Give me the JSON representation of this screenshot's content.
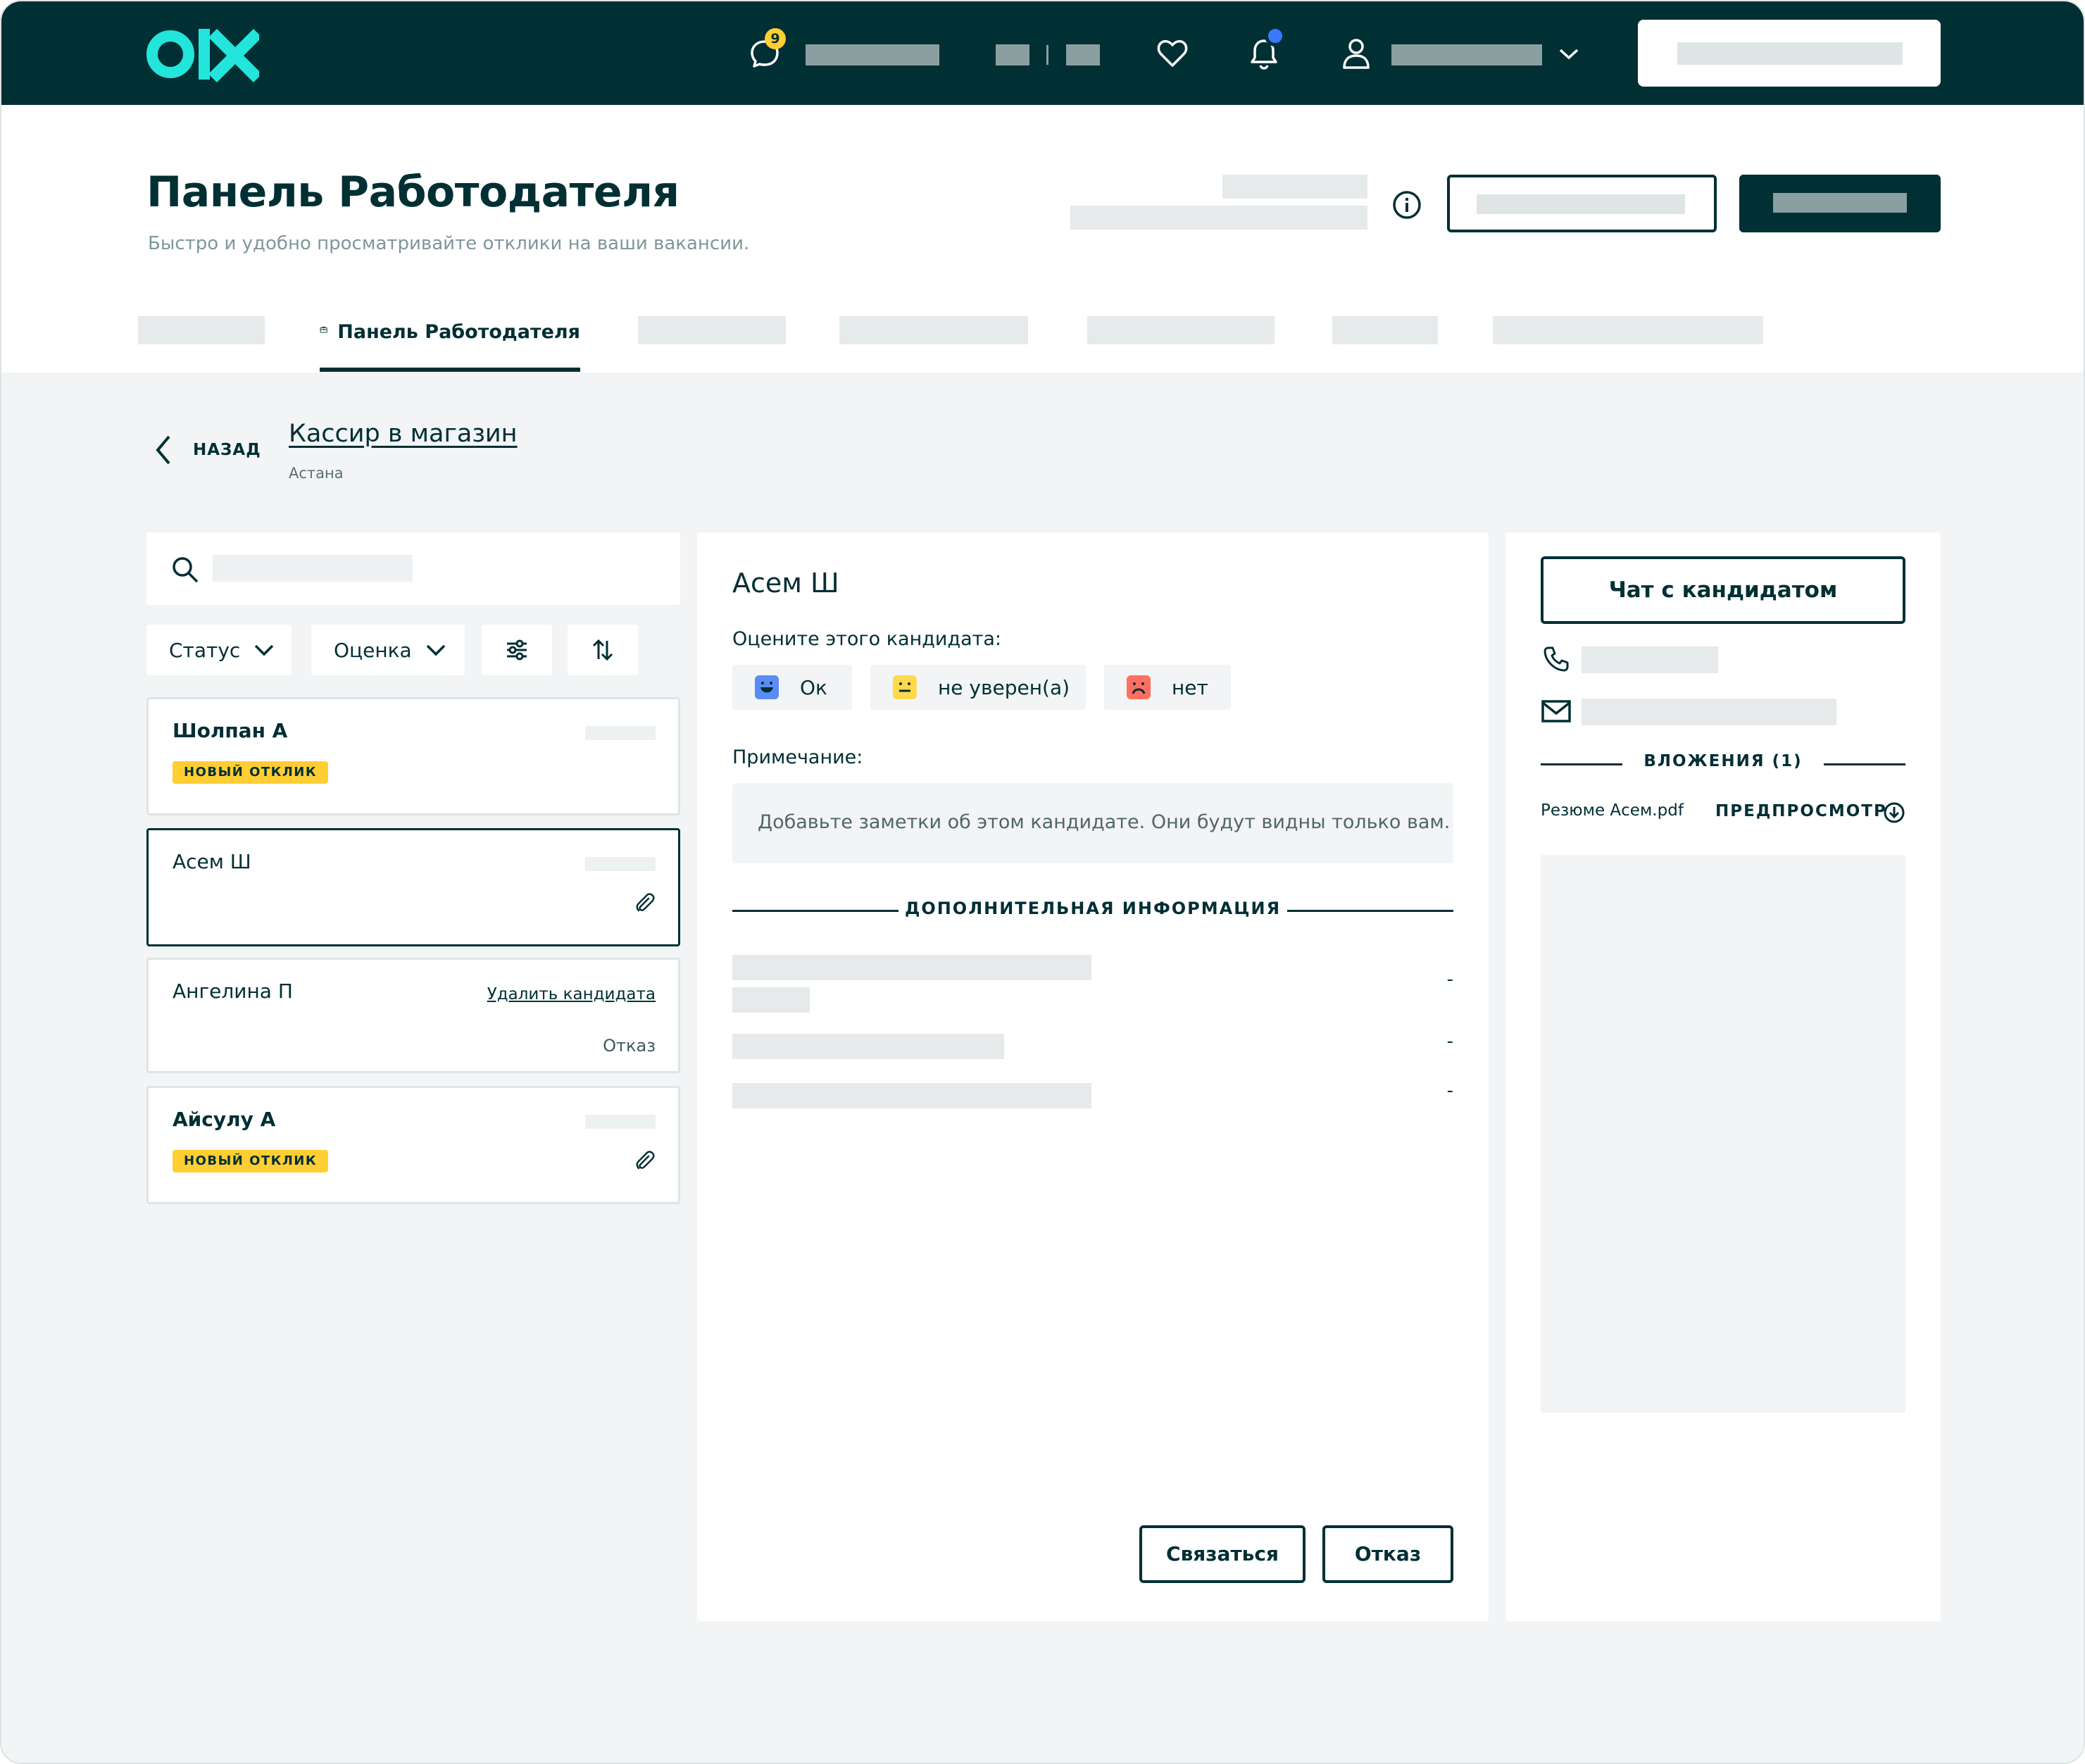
{
  "colors": {
    "header_bg": "#002f34",
    "accent_teal": "#23e5db",
    "badge_yellow": "#ffce32",
    "notification_blue": "#3a77ff",
    "rating_ok": "#5a8cf5",
    "rating_unsure": "#ffd84d",
    "rating_no": "#ff6f61"
  },
  "header": {
    "logo": "olx-logo",
    "chat_badge_count": "9"
  },
  "page": {
    "title": "Панель Работодателя",
    "subtitle": "Быстро и удобно просматривайте отклики на ваши вакансии."
  },
  "tabs": {
    "active_label": "Панель Работодателя"
  },
  "job": {
    "back_label": "НАЗАД",
    "title": "Кассир в магазин",
    "city": "Астана"
  },
  "filters": {
    "status_label": "Статус",
    "rating_label": "Оценка"
  },
  "candidates": [
    {
      "name": "Шолпан А",
      "badge": "НОВЫЙ ОТКЛИК"
    },
    {
      "name": "Асем Ш"
    },
    {
      "name": "Ангелина П",
      "action": "Удалить кандидата",
      "status": "Отказ"
    },
    {
      "name": "Айсулу А",
      "badge": "НОВЫЙ ОТКЛИК"
    }
  ],
  "detail": {
    "name": "Асем Ш",
    "rate_prompt": "Оцените этого кандидата:",
    "rating_options": [
      "Ок",
      "не уверен(а)",
      "нет"
    ],
    "note_label": "Примечание:",
    "note_placeholder": "Добавьте заметки об этом кандидате. Они будут видны только вам.",
    "extra_info_title": "ДОПОЛНИТЕЛЬНАЯ ИНФОРМАЦИЯ",
    "extra_values": [
      "-",
      "-",
      "-"
    ],
    "contact_button": "Связаться",
    "reject_button": "Отказ"
  },
  "sidebar": {
    "chat_button": "Чат с кандидатом",
    "attachments_title": "ВЛОЖЕНИЯ (1)",
    "file_name": "Резюме Асем.pdf",
    "preview_label": "ПРЕДПРОСМОТР"
  }
}
